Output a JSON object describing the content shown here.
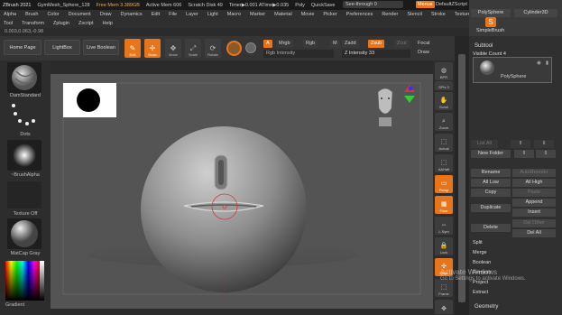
{
  "titlebar": {
    "app": "ZBrush 2021",
    "file": "GymMesh_Sphere_128",
    "warning": "Free Mem 3.389GB",
    "active_mem": "Active Mem 606",
    "scratch": "Scratch Disk 49",
    "timer": "Timer▶0.001 ATime▶0.035",
    "poly": "Poly",
    "quicksave": "QuickSave",
    "seethrough": "See-through 0",
    "menus": "Menus",
    "script": "DefaultZScript"
  },
  "menu_row1": [
    "Alpha",
    "Brush",
    "Color",
    "Document",
    "Draw",
    "Dynamics",
    "Edit",
    "File",
    "Layer",
    "Light",
    "Macro",
    "Marker",
    "Material",
    "Movie",
    "Picker",
    "Preferences",
    "Render",
    "Stencil",
    "Stroke",
    "Texture"
  ],
  "menu_row2": [
    "Tool",
    "Transform",
    "Zplugin",
    "Zscript",
    "Help"
  ],
  "coords": "0.003,0.063,-0.98",
  "toolbar": {
    "home": "Home Page",
    "lightbox": "LightBox",
    "live_boolean": "Live Boolean",
    "edit": "Edit",
    "draw": "Draw",
    "move": "Move",
    "scale": "Scale",
    "rotate": "Rotate",
    "a_chip": "A",
    "mrgb": "Mrgb",
    "rgb": "Rgb",
    "m": "M",
    "zadd": "Zadd",
    "zsub": "Zsub",
    "zcut": "Zcut",
    "rgb_intensity": "Rgb Intensity",
    "z_intensity": "Z Intensity 33",
    "focal": "Focal",
    "draw_size": "Draw"
  },
  "leftpanel": {
    "brush": "DamStandard",
    "stroke": "Dots",
    "alpha": "~BrushAlpha",
    "texture": "Texture Off",
    "material": "MatCap Gray",
    "gradient": "Gradient"
  },
  "rightstrip": [
    "BPR",
    "SPix 3",
    "Scroll",
    "Zoom",
    "Actual",
    "AAHalf",
    "Persp",
    "Floor",
    "L.Sym",
    "Lock",
    "Qxyz",
    "Frame"
  ],
  "rightpanel": {
    "polysphere": "PolySphere",
    "cylinder": "Cylinder3D",
    "simplebrush": "SimpleBrush",
    "subtool_title": "Subtool",
    "visible_count": "Visible Count 4",
    "subtool_item": "PolySphere",
    "list_all": "List All",
    "new_folder": "New Folder",
    "rename": "Rename",
    "autoreorder": "AutoReorder",
    "all_low": "All Low",
    "all_high": "All High",
    "copy": "Copy",
    "paste": "Paste",
    "append": "Append",
    "duplicate": "Duplicate",
    "insert": "Insert",
    "del_other": "Del Other",
    "delete": "Delete",
    "del_all": "Del All",
    "split": "Split",
    "merge": "Merge",
    "boolean": "Boolean",
    "remesh": "Remesh",
    "project": "Project",
    "extract": "Extract",
    "geometry": "Geometry"
  },
  "watermark": {
    "title": "Activate Windows",
    "subtitle": "Go to Settings to activate Windows."
  },
  "colors": {
    "accent": "#e8751a",
    "canvas": "#555555",
    "panel": "#303030"
  }
}
